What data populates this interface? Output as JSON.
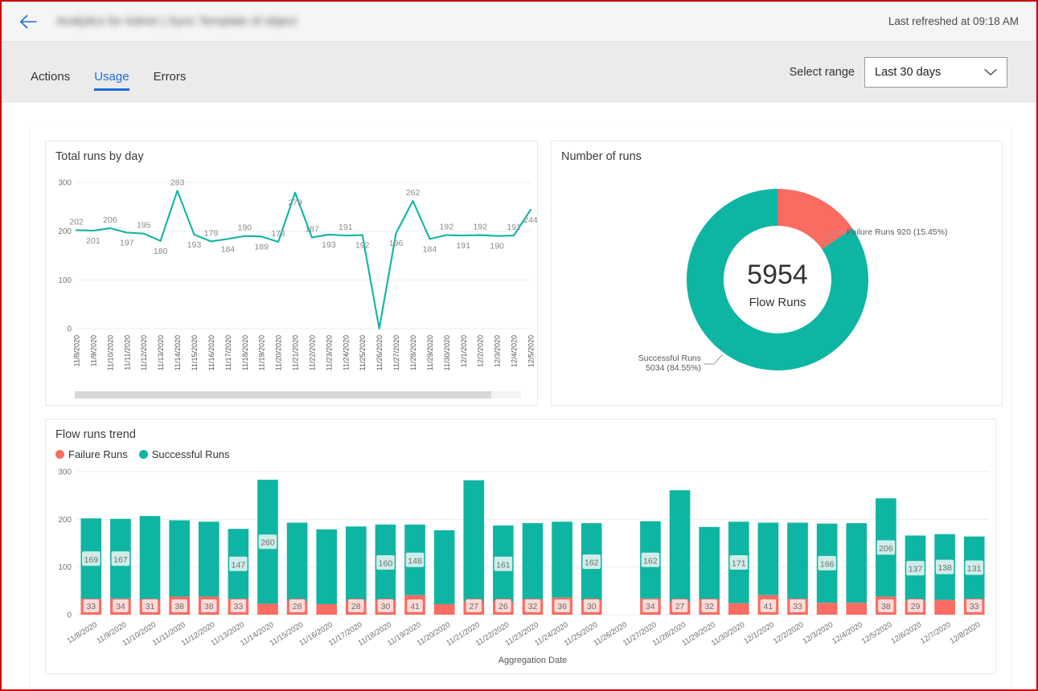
{
  "header": {
    "back_icon": "arrow-left-icon",
    "title": "Analytics for Admin | Sync Template of object",
    "refresh_text": "Last refreshed at 09:18 AM"
  },
  "tabs": [
    {
      "label": "Actions",
      "active": false
    },
    {
      "label": "Usage",
      "active": true
    },
    {
      "label": "Errors",
      "active": false
    }
  ],
  "range": {
    "label": "Select range",
    "value": "Last 30 days",
    "chevron_icon": "chevron-down-icon",
    "options": [
      "Last 30 days"
    ]
  },
  "colors": {
    "teal": "#0FB5A3",
    "teal_dark": "#12B0A0",
    "red": "#FA6B62",
    "red_light": "#FBDAD8",
    "teal_light": "#CFEDE9",
    "accent_blue": "#1a6edb",
    "grid": "#eeeeee"
  },
  "chart_data": [
    {
      "type": "line",
      "title": "Total runs by day",
      "xlabel": "",
      "ylabel": "",
      "ylim": [
        0,
        300
      ],
      "yticks": [
        0,
        100,
        200,
        300
      ],
      "grid": true,
      "legend": "none",
      "series": [
        {
          "name": "Total runs",
          "color": "#0FB5A3",
          "values": [
            202,
            201,
            206,
            197,
            195,
            180,
            283,
            193,
            179,
            184,
            190,
            189,
            178,
            279,
            187,
            193,
            191,
            192,
            0,
            196,
            262,
            184,
            192,
            191,
            192,
            190,
            191,
            244
          ]
        }
      ],
      "categories": [
        "11/8/2020",
        "11/9/2020",
        "11/10/2020",
        "11/11/2020",
        "11/12/2020",
        "11/13/2020",
        "11/14/2020",
        "11/15/2020",
        "11/16/2020",
        "11/17/2020",
        "11/18/2020",
        "11/19/2020",
        "11/20/2020",
        "11/21/2020",
        "11/22/2020",
        "11/23/2020",
        "11/24/2020",
        "11/25/2020",
        "11/26/2020",
        "11/27/2020",
        "11/28/2020",
        "11/29/2020",
        "11/30/2020",
        "12/1/2020",
        "12/2/2020",
        "12/3/2020",
        "12/4/2020",
        "12/5/2020"
      ],
      "scrollbar": true
    },
    {
      "type": "pie",
      "title": "Number of runs",
      "center_value": "5954",
      "center_label": "Flow Runs",
      "slices": [
        {
          "name": "Failure Runs",
          "value": 920,
          "percent": 15.45,
          "color": "#FA6B62",
          "callout": "Failure Runs 920 (15.45%)"
        },
        {
          "name": "Successful Runs",
          "value": 5034,
          "percent": 84.55,
          "color": "#0FB5A3",
          "callout_line1": "Successful Runs",
          "callout_line2": "5034 (84.55%)"
        }
      ]
    },
    {
      "type": "bar",
      "title": "Flow runs trend",
      "stacked": true,
      "xlabel": "Aggregation Date",
      "ylabel": "",
      "ylim": [
        0,
        300
      ],
      "yticks": [
        0,
        100,
        200,
        300
      ],
      "grid": true,
      "legend": [
        "Failure Runs",
        "Successful Runs"
      ],
      "legend_position": "top-left",
      "categories": [
        "11/8/2020",
        "11/9/2020",
        "11/10/2020",
        "11/11/2020",
        "11/12/2020",
        "11/13/2020",
        "11/14/2020",
        "11/15/2020",
        "11/16/2020",
        "11/17/2020",
        "11/18/2020",
        "11/19/2020",
        "11/20/2020",
        "11/21/2020",
        "11/22/2020",
        "11/23/2020",
        "11/24/2020",
        "11/25/2020",
        "11/26/2020",
        "11/27/2020",
        "11/28/2020",
        "11/29/2020",
        "11/30/2020",
        "12/1/2020",
        "12/2/2020",
        "12/3/2020",
        "12/4/2020",
        "12/5/2020",
        "12/6/2020",
        "12/7/2020",
        "12/8/2020"
      ],
      "series": [
        {
          "name": "Failure Runs",
          "color": "#FA6B62",
          "values": [
            33,
            34,
            31,
            38,
            38,
            33,
            23,
            28,
            22,
            28,
            30,
            41,
            22,
            27,
            26,
            32,
            36,
            30,
            0,
            34,
            27,
            32,
            24,
            41,
            33,
            25,
            25,
            38,
            29,
            31,
            33
          ],
          "labels": [
            33,
            34,
            31,
            38,
            38,
            33,
            null,
            28,
            null,
            28,
            30,
            41,
            null,
            27,
            26,
            32,
            36,
            30,
            null,
            34,
            27,
            32,
            null,
            41,
            33,
            null,
            null,
            38,
            29,
            null,
            33
          ]
        },
        {
          "name": "Successful Runs",
          "color": "#0FB5A3",
          "values": [
            169,
            167,
            176,
            160,
            157,
            147,
            260,
            165,
            157,
            157,
            159,
            148,
            155,
            255,
            161,
            160,
            159,
            162,
            0,
            162,
            234,
            152,
            171,
            152,
            160,
            166,
            167,
            206,
            137,
            138,
            131
          ],
          "labels": [
            169,
            167,
            null,
            null,
            null,
            147,
            260,
            null,
            null,
            null,
            160,
            148,
            null,
            null,
            161,
            null,
            null,
            162,
            null,
            162,
            null,
            null,
            171,
            null,
            null,
            166,
            null,
            206,
            137,
            138,
            131
          ]
        }
      ],
      "totals": [
        202,
        201,
        207,
        198,
        195,
        180,
        283,
        193,
        179,
        185,
        189,
        189,
        177,
        282,
        187,
        192,
        195,
        192,
        0,
        196,
        261,
        184,
        195,
        193,
        193,
        191,
        192,
        244,
        166,
        169,
        164
      ]
    }
  ]
}
